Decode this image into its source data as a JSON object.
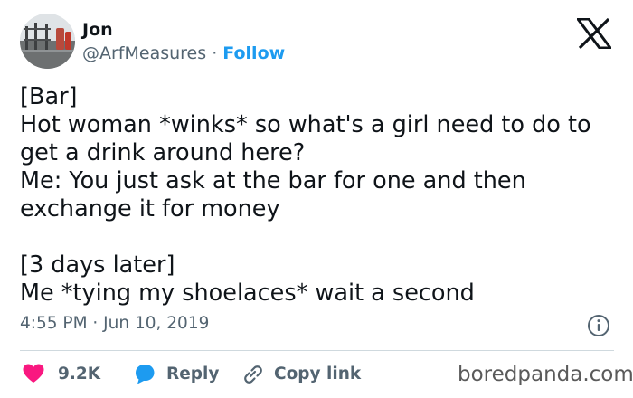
{
  "author": {
    "display_name": "Jon",
    "handle": "@ArfMeasures",
    "separator": " · ",
    "follow_label": "Follow"
  },
  "tweet": {
    "lines": [
      "[Bar]",
      "Hot woman *winks* so what's a girl need to do to",
      "get a drink around here?",
      "Me: You just ask at the bar for one and then",
      "exchange it for money",
      "",
      "[3 days later]",
      "Me *tying my shoelaces* wait a second"
    ],
    "timestamp": "4:55 PM · Jun 10, 2019"
  },
  "actions": {
    "like_count": "9.2K",
    "reply_label": "Reply",
    "copy_link_label": "Copy link"
  },
  "watermark": "boredpanda.com",
  "colors": {
    "text": "#0f1419",
    "secondary": "#536471",
    "link": "#1d9bf0",
    "like": "#f91880",
    "reply": "#1d9bf0",
    "divider": "#cfd9de"
  },
  "icons": {
    "brand": "x-logo-icon",
    "info": "info-icon",
    "like": "heart-icon",
    "reply": "speech-bubble-icon",
    "copy_link": "link-icon"
  }
}
